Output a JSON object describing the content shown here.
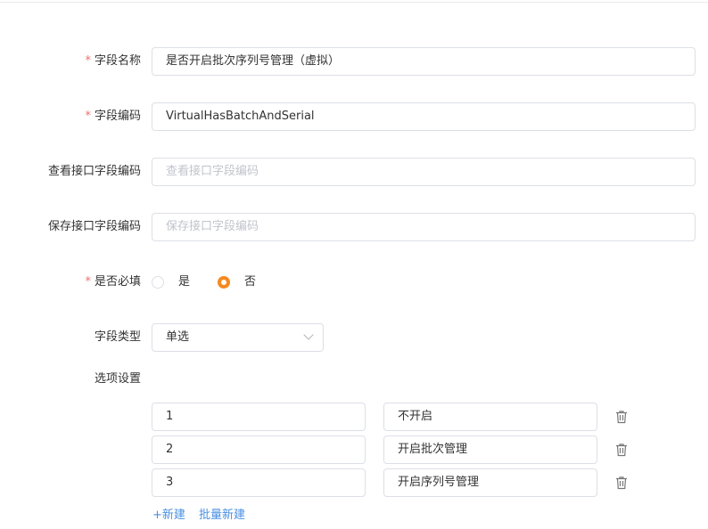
{
  "form": {
    "field_name": {
      "label": "字段名称",
      "required": true,
      "value": "是否开启批次序列号管理（虚拟）"
    },
    "field_code": {
      "label": "字段编码",
      "required": true,
      "value": "VirtualHasBatchAndSerial"
    },
    "view_api_code": {
      "label": "查看接口字段编码",
      "required": false,
      "value": "",
      "placeholder": "查看接口字段编码"
    },
    "save_api_code": {
      "label": "保存接口字段编码",
      "required": false,
      "value": "",
      "placeholder": "保存接口字段编码"
    },
    "is_required": {
      "label": "是否必填",
      "required": true,
      "options": [
        "是",
        "否"
      ],
      "selected": "否"
    },
    "field_type": {
      "label": "字段类型",
      "value": "单选"
    },
    "option_settings": {
      "label": "选项设置"
    },
    "options": [
      {
        "value": "1",
        "text": "不开启"
      },
      {
        "value": "2",
        "text": "开启批次管理"
      },
      {
        "value": "3",
        "text": "开启序列号管理"
      }
    ],
    "required_mark": "*",
    "add_label": "+新建",
    "batch_add_label": "批量新建"
  },
  "colors": {
    "accent": "#f5891f",
    "link": "#4a90e2",
    "required": "#f56c6c",
    "border": "#dcdfe6"
  },
  "icons": {
    "delete": "trash-icon",
    "dropdown": "chevron-down-icon"
  }
}
